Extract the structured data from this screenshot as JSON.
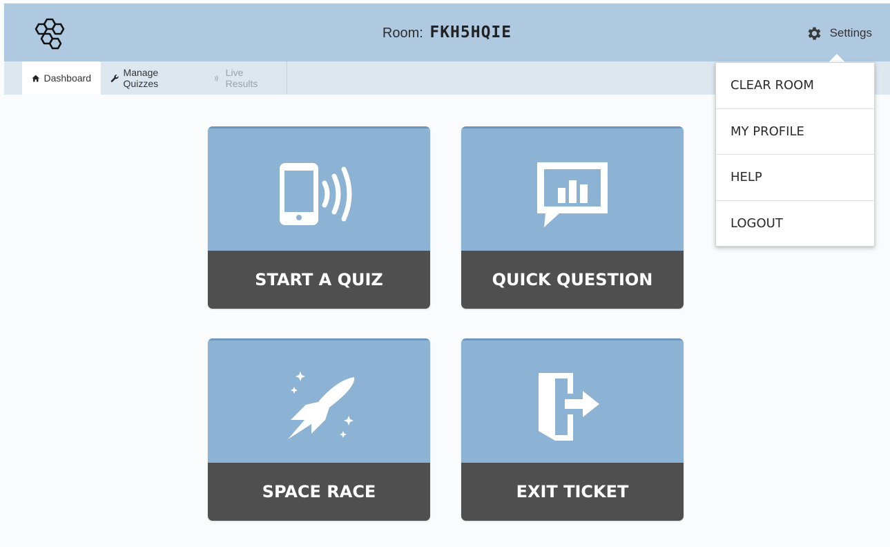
{
  "header": {
    "room_label": "Room:",
    "room_code": "FKH5HQIE",
    "settings_label": "Settings"
  },
  "nav": {
    "tabs": [
      {
        "label": "Dashboard",
        "icon": "home-icon",
        "state": "active"
      },
      {
        "label": "Manage Quizzes",
        "icon": "wrench-icon",
        "state": "normal"
      },
      {
        "label": "Live Results",
        "icon": "broadcast-icon",
        "state": "disabled"
      }
    ]
  },
  "tiles": [
    {
      "label": "START A QUIZ",
      "icon": "phone-broadcast-icon"
    },
    {
      "label": "QUICK QUESTION",
      "icon": "chart-speech-bubble-icon"
    },
    {
      "label": "SPACE RACE",
      "icon": "rocket-icon"
    },
    {
      "label": "EXIT TICKET",
      "icon": "exit-door-icon"
    }
  ],
  "settings_menu": {
    "items": [
      "CLEAR ROOM",
      "MY PROFILE",
      "HELP",
      "LOGOUT"
    ]
  },
  "colors": {
    "header_bg": "#afcae0",
    "nav_bg": "#dde7f0",
    "tile_top": "#8db3d4",
    "tile_bottom": "#4f4f4f"
  }
}
